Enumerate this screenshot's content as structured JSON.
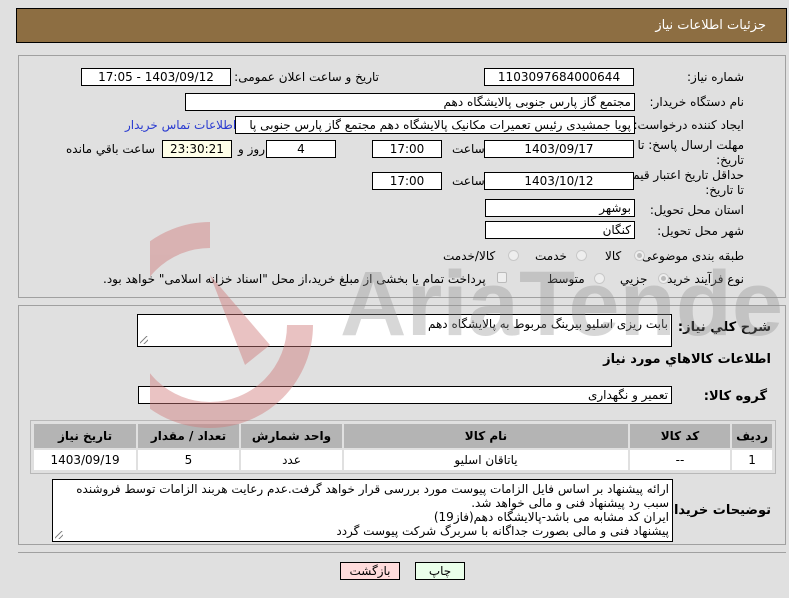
{
  "header": {
    "title": "جزئیات اطلاعات نیاز"
  },
  "form": {
    "need_number": {
      "label": "شماره نیاز:",
      "value": "1103097684000644"
    },
    "announce_datetime": {
      "label": "تاریخ و ساعت اعلان عمومی:",
      "value": "1403/09/12 - 17:05"
    },
    "buyer_org": {
      "label": "نام دستگاه خریدار:",
      "value": "مجتمع گاز پارس جنوبی  پالایشگاه دهم"
    },
    "requester": {
      "label": "ایجاد کننده درخواست:",
      "value": "پویا جمشیدی رئیس تعمیرات مکانیک پالایشگاه دهم  مجتمع گاز پارس جنوبی  پا"
    },
    "buyer_contact_link": "اطلاعات تماس خریدار",
    "reply_deadline": {
      "label": "مهلت ارسال پاسخ: تا تاریخ:",
      "date": "1403/09/17",
      "time_label": "ساعت",
      "time": "17:00",
      "days": "4",
      "days_label": "روز و",
      "remaining": "23:30:21",
      "remaining_label": "ساعت باقي مانده"
    },
    "price_validity": {
      "label": "حداقل تاریخ اعتبار قیمت: تا تاریخ:",
      "date": "1403/10/12",
      "time_label": "ساعت",
      "time": "17:00"
    },
    "province": {
      "label": "استان محل تحویل:",
      "value": "بوشهر"
    },
    "city": {
      "label": "شهر محل تحویل:",
      "value": "کنگان"
    },
    "category": {
      "label": "طبقه بندی موضوعی:",
      "options": [
        {
          "label": "کالا",
          "checked": true
        },
        {
          "label": "خدمت",
          "checked": false
        },
        {
          "label": "کالا/خدمت",
          "checked": false
        }
      ]
    },
    "process_type": {
      "label": "نوع فرآیند خرید :",
      "options": [
        {
          "label": "جزیي",
          "checked": true
        },
        {
          "label": "متوسط",
          "checked": false
        }
      ],
      "treasury_checkbox": {
        "label": "پرداخت تمام یا بخشی از مبلغ خرید،از محل \"اسناد خزانه اسلامی\" خواهد بود.",
        "checked": false
      }
    }
  },
  "summary": {
    "label": "شرح کلي نياز:",
    "value": "بابت ریزی اسلیو بیرینگ مربوط به پالایشگاه دهم"
  },
  "goods_section": {
    "title": "اطلاعات کالاهاي مورد نياز",
    "group_label": "گروه کالا:",
    "group_value": "تعمیر و نگهداری",
    "table": {
      "headers": [
        "ردیف",
        "کد کالا",
        "نام کالا",
        "واحد شمارش",
        "تعداد / مقدار",
        "تاریخ نیاز"
      ],
      "rows": [
        [
          "1",
          "--",
          "یاتاقان اسلیو",
          "عدد",
          "5",
          "1403/09/19"
        ]
      ]
    }
  },
  "buyer_notes": {
    "label": "توضیحات خریدار:",
    "lines": [
      "ارائه پیشنهاد بر اساس فایل الزامات پیوست مورد بررسی قرار خواهد گرفت.عدم رعایت هربند الزامات توسط فروشنده سبب رد پیشنهاد فنی و مالی خواهد شد.",
      "ایران کد مشابه می باشد-پالایشگاه دهم(فاز19)",
      "پیشنهاد فنی و مالی بصورت جداگانه با سربرگ شرکت پیوست گردد"
    ]
  },
  "buttons": {
    "print": "چاپ",
    "back": "بازگشت"
  },
  "watermark": {
    "text": "AriaTender.neT"
  },
  "colors": {
    "header_bg": "#8d6e42",
    "link": "#2a3bd0",
    "print_btn_bg": "#eaffea",
    "back_btn_bg": "#ffdcdc",
    "watermark_red": "#d8a0a0"
  }
}
